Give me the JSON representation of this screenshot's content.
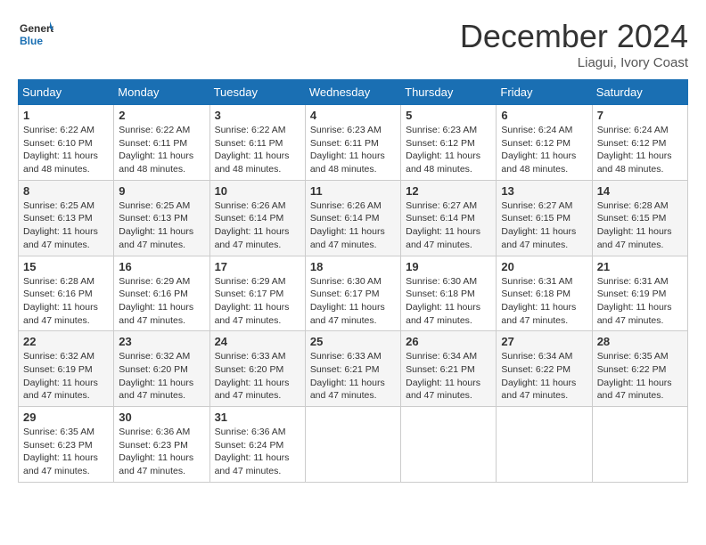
{
  "logo": {
    "text_general": "General",
    "text_blue": "Blue"
  },
  "header": {
    "month_title": "December 2024",
    "location": "Liagui, Ivory Coast"
  },
  "weekdays": [
    "Sunday",
    "Monday",
    "Tuesday",
    "Wednesday",
    "Thursday",
    "Friday",
    "Saturday"
  ],
  "weeks": [
    [
      {
        "day": "1",
        "sunrise": "6:22 AM",
        "sunset": "6:10 PM",
        "daylight": "11 hours and 48 minutes."
      },
      {
        "day": "2",
        "sunrise": "6:22 AM",
        "sunset": "6:11 PM",
        "daylight": "11 hours and 48 minutes."
      },
      {
        "day": "3",
        "sunrise": "6:22 AM",
        "sunset": "6:11 PM",
        "daylight": "11 hours and 48 minutes."
      },
      {
        "day": "4",
        "sunrise": "6:23 AM",
        "sunset": "6:11 PM",
        "daylight": "11 hours and 48 minutes."
      },
      {
        "day": "5",
        "sunrise": "6:23 AM",
        "sunset": "6:12 PM",
        "daylight": "11 hours and 48 minutes."
      },
      {
        "day": "6",
        "sunrise": "6:24 AM",
        "sunset": "6:12 PM",
        "daylight": "11 hours and 48 minutes."
      },
      {
        "day": "7",
        "sunrise": "6:24 AM",
        "sunset": "6:12 PM",
        "daylight": "11 hours and 48 minutes."
      }
    ],
    [
      {
        "day": "8",
        "sunrise": "6:25 AM",
        "sunset": "6:13 PM",
        "daylight": "11 hours and 47 minutes."
      },
      {
        "day": "9",
        "sunrise": "6:25 AM",
        "sunset": "6:13 PM",
        "daylight": "11 hours and 47 minutes."
      },
      {
        "day": "10",
        "sunrise": "6:26 AM",
        "sunset": "6:14 PM",
        "daylight": "11 hours and 47 minutes."
      },
      {
        "day": "11",
        "sunrise": "6:26 AM",
        "sunset": "6:14 PM",
        "daylight": "11 hours and 47 minutes."
      },
      {
        "day": "12",
        "sunrise": "6:27 AM",
        "sunset": "6:14 PM",
        "daylight": "11 hours and 47 minutes."
      },
      {
        "day": "13",
        "sunrise": "6:27 AM",
        "sunset": "6:15 PM",
        "daylight": "11 hours and 47 minutes."
      },
      {
        "day": "14",
        "sunrise": "6:28 AM",
        "sunset": "6:15 PM",
        "daylight": "11 hours and 47 minutes."
      }
    ],
    [
      {
        "day": "15",
        "sunrise": "6:28 AM",
        "sunset": "6:16 PM",
        "daylight": "11 hours and 47 minutes."
      },
      {
        "day": "16",
        "sunrise": "6:29 AM",
        "sunset": "6:16 PM",
        "daylight": "11 hours and 47 minutes."
      },
      {
        "day": "17",
        "sunrise": "6:29 AM",
        "sunset": "6:17 PM",
        "daylight": "11 hours and 47 minutes."
      },
      {
        "day": "18",
        "sunrise": "6:30 AM",
        "sunset": "6:17 PM",
        "daylight": "11 hours and 47 minutes."
      },
      {
        "day": "19",
        "sunrise": "6:30 AM",
        "sunset": "6:18 PM",
        "daylight": "11 hours and 47 minutes."
      },
      {
        "day": "20",
        "sunrise": "6:31 AM",
        "sunset": "6:18 PM",
        "daylight": "11 hours and 47 minutes."
      },
      {
        "day": "21",
        "sunrise": "6:31 AM",
        "sunset": "6:19 PM",
        "daylight": "11 hours and 47 minutes."
      }
    ],
    [
      {
        "day": "22",
        "sunrise": "6:32 AM",
        "sunset": "6:19 PM",
        "daylight": "11 hours and 47 minutes."
      },
      {
        "day": "23",
        "sunrise": "6:32 AM",
        "sunset": "6:20 PM",
        "daylight": "11 hours and 47 minutes."
      },
      {
        "day": "24",
        "sunrise": "6:33 AM",
        "sunset": "6:20 PM",
        "daylight": "11 hours and 47 minutes."
      },
      {
        "day": "25",
        "sunrise": "6:33 AM",
        "sunset": "6:21 PM",
        "daylight": "11 hours and 47 minutes."
      },
      {
        "day": "26",
        "sunrise": "6:34 AM",
        "sunset": "6:21 PM",
        "daylight": "11 hours and 47 minutes."
      },
      {
        "day": "27",
        "sunrise": "6:34 AM",
        "sunset": "6:22 PM",
        "daylight": "11 hours and 47 minutes."
      },
      {
        "day": "28",
        "sunrise": "6:35 AM",
        "sunset": "6:22 PM",
        "daylight": "11 hours and 47 minutes."
      }
    ],
    [
      {
        "day": "29",
        "sunrise": "6:35 AM",
        "sunset": "6:23 PM",
        "daylight": "11 hours and 47 minutes."
      },
      {
        "day": "30",
        "sunrise": "6:36 AM",
        "sunset": "6:23 PM",
        "daylight": "11 hours and 47 minutes."
      },
      {
        "day": "31",
        "sunrise": "6:36 AM",
        "sunset": "6:24 PM",
        "daylight": "11 hours and 47 minutes."
      },
      null,
      null,
      null,
      null
    ]
  ],
  "labels": {
    "sunrise": "Sunrise: ",
    "sunset": "Sunset: ",
    "daylight": "Daylight: "
  }
}
